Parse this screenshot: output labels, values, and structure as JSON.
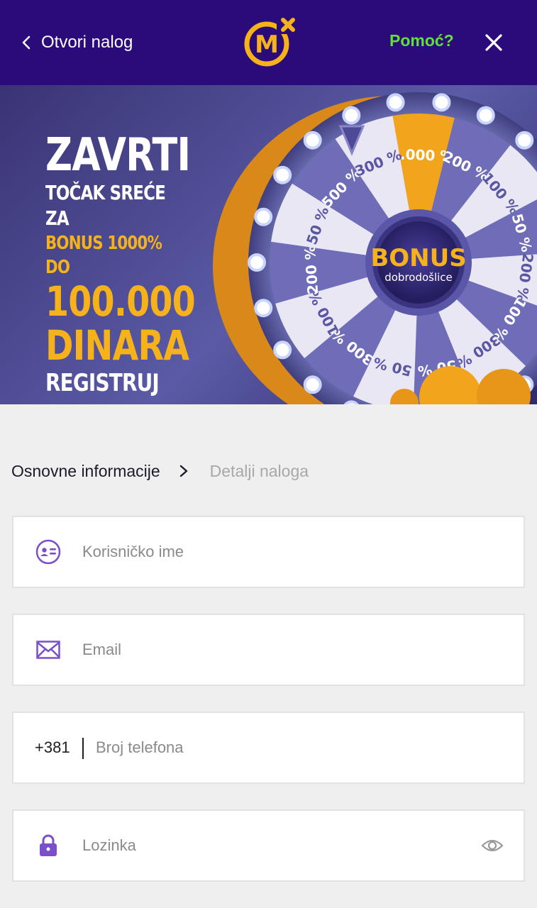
{
  "header": {
    "back_label": "Otvori nalog",
    "logo_text": "M",
    "help_label": "Pomoć?",
    "brand_color": "#2b0a7a",
    "help_color": "#5fe03a",
    "logo_color": "#f6b21b"
  },
  "banner": {
    "line1": "ZAVRTI",
    "line2": "TOČAK SREĆE ZA",
    "line3": "BONUS 1000% DO",
    "line4": "100.000",
    "line5": "DINARA",
    "line6": "REGISTRUJ SE",
    "wheel_center_title": "BONUS",
    "wheel_center_sub": "dobrodošlice",
    "wheel_segments": [
      "1.000 %",
      "200 %",
      "100 %",
      "50 %",
      "200 %",
      "100 %",
      "300 %",
      "50 %",
      "50 %",
      "300 %",
      "100 %",
      "200 %",
      "50 %",
      "500 %",
      "300 %"
    ]
  },
  "steps": {
    "active": "Osnovne informacije",
    "next": "Detalji naloga"
  },
  "form": {
    "username_placeholder": "Korisničko ime",
    "email_placeholder": "Email",
    "phone_prefix": "+381",
    "phone_placeholder": "Broj telefona",
    "password_placeholder": "Lozinka",
    "icon_color": "#7b4fc9"
  }
}
